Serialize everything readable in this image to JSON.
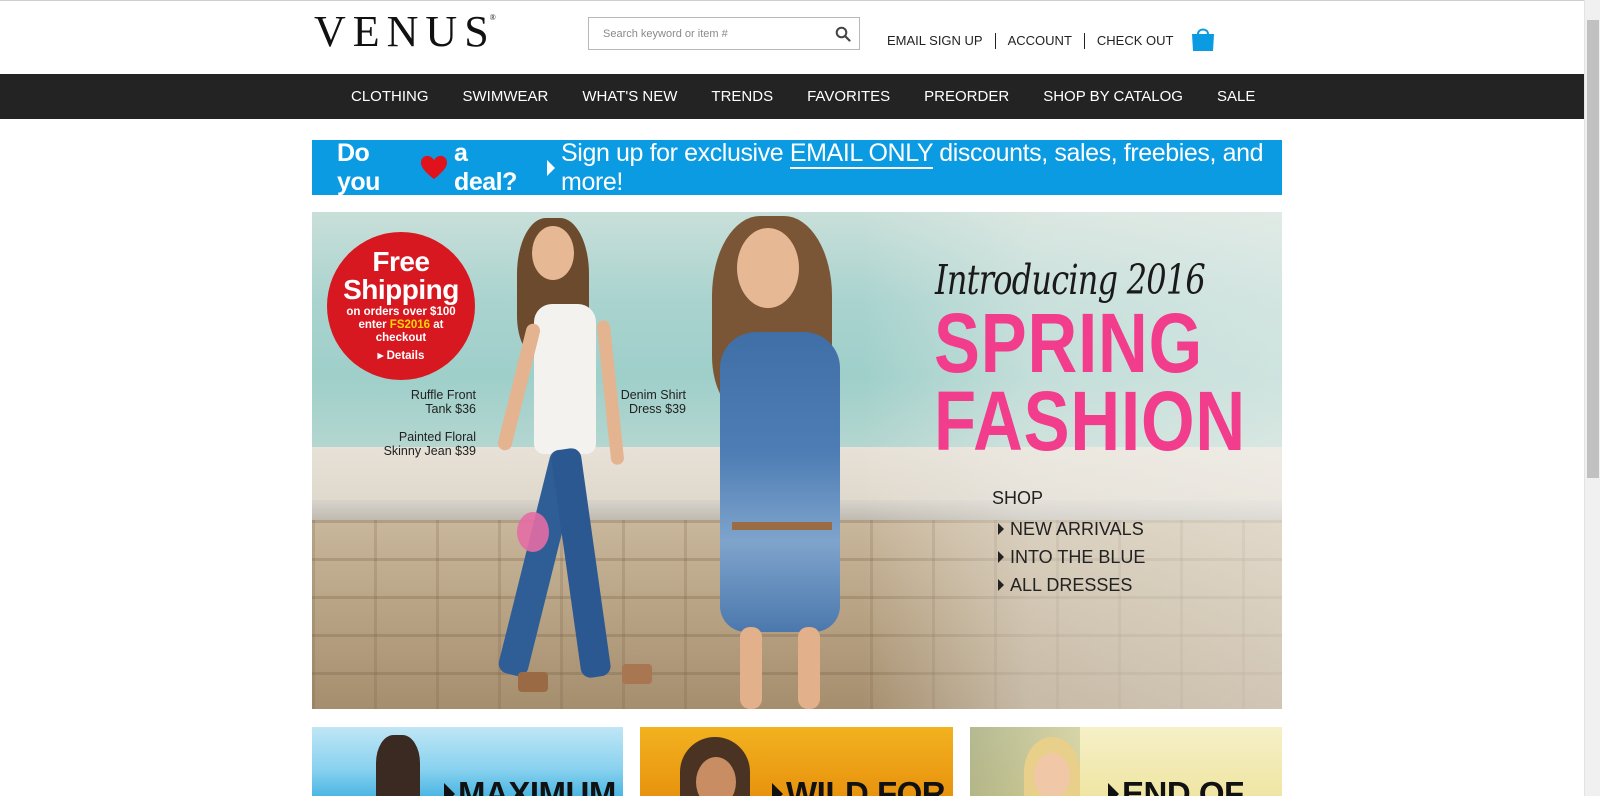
{
  "header": {
    "logo": "VENUS",
    "logo_mark": "®",
    "search_placeholder": "Search keyword or item #",
    "links": [
      "EMAIL SIGN UP",
      "ACCOUNT",
      "CHECK OUT"
    ],
    "icons": {
      "search": "search-icon",
      "bag": "shopping-bag-icon"
    }
  },
  "nav": {
    "items": [
      "CLOTHING",
      "SWIMWEAR",
      "WHAT'S NEW",
      "TRENDS",
      "FAVORITES",
      "PREORDER",
      "SHOP BY CATALOG",
      "SALE"
    ]
  },
  "promo": {
    "question_pre": "Do you",
    "question_post": "a deal?",
    "msg_pre": "Sign up for exclusive",
    "msg_em": "EMAIL ONLY",
    "msg_post": "discounts, sales, freebies, and more!"
  },
  "hero": {
    "badge": {
      "line1": "Free",
      "line2": "Shipping",
      "line3": "on orders over $100",
      "line4_pre": "enter",
      "code": "FS2016",
      "line4_post": "at",
      "line5": "checkout",
      "details": "Details"
    },
    "captions": [
      {
        "line1": "Ruffle Front",
        "line2": "Tank $36"
      },
      {
        "line1": "Painted Floral",
        "line2": "Skinny Jean $39"
      },
      {
        "line1": "Denim Shirt",
        "line2": "Dress $39"
      }
    ],
    "intro": "Introducing 2016",
    "headline1": "SPRING",
    "headline2": "FASHION",
    "shop": "SHOP",
    "shop_links": [
      "NEW ARRIVALS",
      "INTO THE BLUE",
      "ALL DRESSES"
    ]
  },
  "tiles": [
    {
      "label": "MAXIMUM"
    },
    {
      "label": "WILD FOR"
    },
    {
      "label": "END OF"
    }
  ],
  "colors": {
    "nav_bg": "#232323",
    "promo_bg": "#0b9be3",
    "accent_pink": "#f23c8c",
    "badge_red": "#d81820",
    "bag_blue": "#0b9be3"
  }
}
